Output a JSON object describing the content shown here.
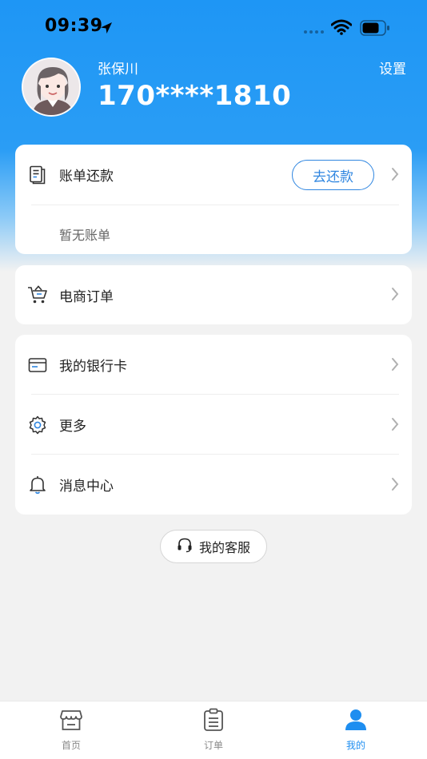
{
  "status_bar": {
    "time": "09:39"
  },
  "profile": {
    "name": "张保川",
    "phone": "170****1810",
    "settings_label": "设置"
  },
  "bill_card": {
    "title": "账单还款",
    "repay_button": "去还款",
    "empty_text": "暂无账单"
  },
  "order_card": {
    "title": "电商订单"
  },
  "menu_card": {
    "items": [
      {
        "label": "我的银行卡",
        "icon": "bank-card-icon"
      },
      {
        "label": "更多",
        "icon": "gear-icon"
      },
      {
        "label": "消息中心",
        "icon": "bell-icon"
      }
    ]
  },
  "service_button": {
    "label": "我的客服"
  },
  "tab_bar": {
    "tabs": [
      {
        "label": "首页",
        "icon": "store-icon"
      },
      {
        "label": "订单",
        "icon": "clipboard-icon"
      },
      {
        "label": "我的",
        "icon": "person-icon",
        "active": true
      }
    ]
  },
  "colors": {
    "brand_blue": "#1e96f5",
    "accent": "#2f86e0",
    "background": "#f2f2f2"
  }
}
